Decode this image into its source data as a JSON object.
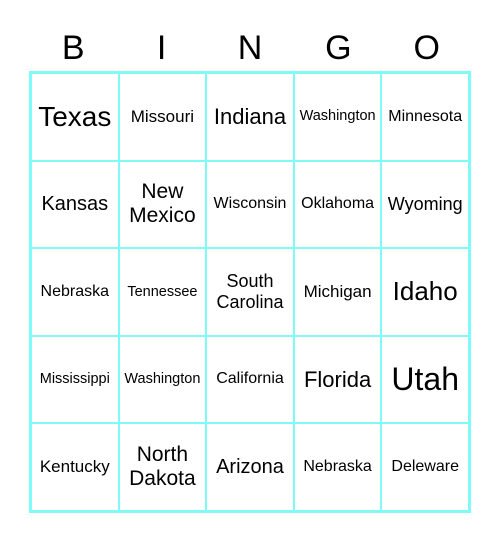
{
  "header": {
    "letters": [
      "B",
      "I",
      "N",
      "G",
      "O"
    ]
  },
  "colors": {
    "grid_border": "#7ffbf7"
  },
  "card": {
    "rows": [
      [
        "Texas",
        "Missouri",
        "Indiana",
        "Washington",
        "Minnesota"
      ],
      [
        "Kansas",
        "New Mexico",
        "Wisconsin",
        "Oklahoma",
        "Wyoming"
      ],
      [
        "Nebraska",
        "Tennessee",
        "South Carolina",
        "Michigan",
        "Idaho"
      ],
      [
        "Mississippi",
        "Washington",
        "California",
        "Florida",
        "Utah"
      ],
      [
        "Kentucky",
        "North Dakota",
        "Arizona",
        "Nebraska",
        "Deleware"
      ]
    ]
  }
}
